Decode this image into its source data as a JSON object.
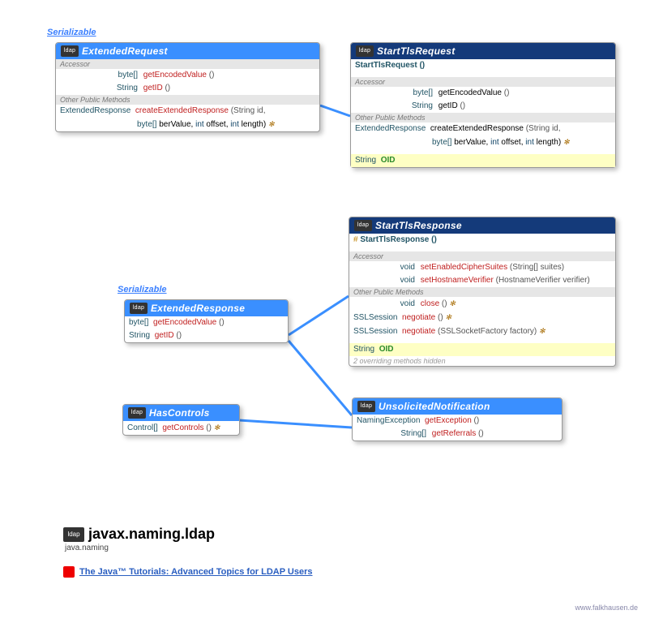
{
  "colors": {
    "blue": "#3a8fff",
    "navy": "#143a7a"
  },
  "labels": {
    "serializable": "Serializable",
    "accessor": "Accessor",
    "otherPublic": "Other Public Methods"
  },
  "package": {
    "name": "javax.naming.ldap",
    "parent": "java.naming"
  },
  "tutorial": "The Java™ Tutorials: Advanced Topics for LDAP Users",
  "footer": "www.falkhausen.de",
  "extendedRequest": {
    "name": "ExtendedRequest",
    "rows": [
      {
        "ret": "byte[]",
        "name": "getEncodedValue",
        "params": "()"
      },
      {
        "ret": "String",
        "name": "getID",
        "params": "()"
      }
    ],
    "other": {
      "ret": "ExtendedResponse",
      "name": "createExtendedResponse",
      "params": "(String id,",
      "line2": "byte[] berValue, int offset, int length)",
      "throws": "✻"
    }
  },
  "startTlsRequest": {
    "name": "StartTlsRequest",
    "constructor": "StartTlsRequest ()",
    "rows": [
      {
        "ret": "byte[]",
        "name": "getEncodedValue",
        "params": "()"
      },
      {
        "ret": "String",
        "name": "getID",
        "params": "()"
      }
    ],
    "other": {
      "ret": "ExtendedResponse",
      "name": "createExtendedResponse",
      "params": "(String id,",
      "line2": "byte[] berValue, int offset, int length)",
      "throws": "✻"
    },
    "field": {
      "type": "String",
      "name": "OID"
    }
  },
  "extendedResponse": {
    "name": "ExtendedResponse",
    "rows": [
      {
        "ret": "byte[]",
        "name": "getEncodedValue",
        "params": "()"
      },
      {
        "ret": "String",
        "name": "getID",
        "params": "()"
      }
    ]
  },
  "startTlsResponse": {
    "name": "StartTlsResponse",
    "constructor": "StartTlsResponse ()",
    "accessor": [
      {
        "ret": "void",
        "name": "setEnabledCipherSuites",
        "params": "(String[] suites)"
      },
      {
        "ret": "void",
        "name": "setHostnameVerifier",
        "params": "(HostnameVerifier verifier)"
      }
    ],
    "other": [
      {
        "ret": "void",
        "name": "close",
        "params": "()",
        "throws": "✻"
      },
      {
        "ret": "SSLSession",
        "name": "negotiate",
        "params": "()",
        "throws": "✻"
      },
      {
        "ret": "SSLSession",
        "name": "negotiate",
        "params": "(SSLSocketFactory factory)",
        "throws": "✻"
      }
    ],
    "field": {
      "type": "String",
      "name": "OID"
    },
    "hidden": "2 overriding methods hidden"
  },
  "hasControls": {
    "name": "HasControls",
    "rows": [
      {
        "ret": "Control[]",
        "name": "getControls",
        "params": "()",
        "throws": "✻"
      }
    ]
  },
  "unsolicited": {
    "name": "UnsolicitedNotification",
    "rows": [
      {
        "ret": "NamingException",
        "name": "getException",
        "params": "()"
      },
      {
        "ret": "String[]",
        "name": "getReferrals",
        "params": "()"
      }
    ]
  }
}
